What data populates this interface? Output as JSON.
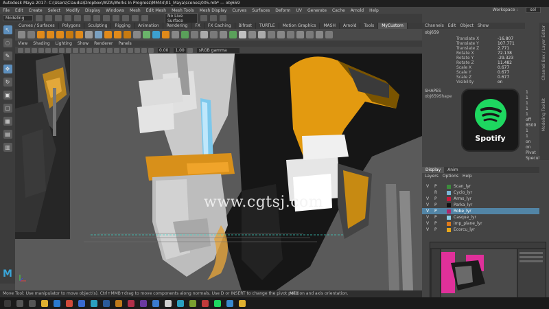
{
  "window": {
    "title": "Autodesk Maya 2017: C:\\Users\\Claudia\\Dropbox\\WZA\\Works In Progress\\MM44\\01_Maya\\scenes\\005.mb* — obj659"
  },
  "menubar": {
    "items": [
      "File",
      "Edit",
      "Create",
      "Select",
      "Modify",
      "Display",
      "Windows",
      "Mesh",
      "Edit Mesh",
      "Mesh Tools",
      "Mesh Display",
      "Curves",
      "Surfaces",
      "Deform",
      "UV",
      "Generate",
      "Cache",
      "Arnold",
      "Help"
    ],
    "workspace_label": "Workspace :",
    "workspace_value": "sel"
  },
  "statusline": {
    "mode": "Modeling",
    "live_surface": "No Live Surface"
  },
  "shelf": {
    "tabs": [
      "Curves / Surfaces",
      "Polygons",
      "Sculpting",
      "Rigging",
      "Animation",
      "Rendering",
      "FX",
      "FX Caching",
      "Bifrost",
      "TURTLE",
      "Motion Graphics",
      "MASH",
      "Arnold",
      "Tools",
      "MyCustom"
    ],
    "active_tab": "MyCustom"
  },
  "viewport": {
    "menu": [
      "View",
      "Shading",
      "Lighting",
      "Show",
      "Renderer",
      "Panels"
    ],
    "near_value": "0.00",
    "far_value": "1.00",
    "color_space": "sRGB gamma",
    "watermark": "www.cgtsj.com"
  },
  "channel_box": {
    "menu": [
      "Channels",
      "Edit",
      "Object",
      "Show"
    ],
    "object_name": "obj659",
    "attributes": [
      {
        "label": "Translate X",
        "value": "-16.807"
      },
      {
        "label": "Translate Y",
        "value": "107.771"
      },
      {
        "label": "Translate Z",
        "value": "2.771"
      },
      {
        "label": "Rotate X",
        "value": "72.138"
      },
      {
        "label": "Rotate Y",
        "value": "-29.323"
      },
      {
        "label": "Rotate Z",
        "value": "11.482"
      },
      {
        "label": "Scale X",
        "value": "0.677"
      },
      {
        "label": "Scale Y",
        "value": "0.677"
      },
      {
        "label": "Scale Z",
        "value": "0.677"
      },
      {
        "label": "Visibility",
        "value": "on"
      }
    ],
    "shapes_label": "SHAPES",
    "shape_name": "obj659Shape",
    "side_values": [
      "1",
      "1",
      "1",
      "1",
      "1",
      "off",
      "8500",
      "1",
      "1",
      "on",
      "on"
    ],
    "side_bottom_label": "Pivot Specular"
  },
  "spotify": {
    "brand_text": "Spotify",
    "brand_color": "#1ed760"
  },
  "vertical_tabs": [
    "Channel Box / Layer Editor",
    "Modeling Toolkit"
  ],
  "layer_editor": {
    "tabs": [
      "Display",
      "Anim"
    ],
    "active_tab": "Display",
    "menu": [
      "Layers",
      "Options",
      "Help"
    ],
    "layers": [
      {
        "v": "V",
        "p": "P",
        "name": "Scan_lyr",
        "color": "#3c8c3c",
        "selected": false
      },
      {
        "v": "",
        "p": "R",
        "name": "Cyclo_lyr",
        "color": "#7ab6d6",
        "selected": false
      },
      {
        "v": "V",
        "p": "P",
        "name": "Arms_lyr",
        "color": "#c8183c",
        "selected": false
      },
      {
        "v": "V",
        "p": "P",
        "name": "Parka_lyr",
        "color": "#111111",
        "selected": false
      },
      {
        "v": "V",
        "p": "P",
        "name": "Robe_lyr",
        "color": "#b0286a",
        "selected": true
      },
      {
        "v": "V",
        "p": "P",
        "name": "Casque_lyr",
        "color": "#8ed0e8",
        "selected": false
      },
      {
        "v": "V",
        "p": "P",
        "name": "imp_plane_lyr",
        "color": "#e07a1a",
        "selected": false
      },
      {
        "v": "V",
        "p": "P",
        "name": "Ecorcu_lyr",
        "color": "#e8a81a",
        "selected": false
      }
    ]
  },
  "status": {
    "help_line": "Move Tool: Use manipulator to move object(s). Ctrl+MMB+drag to move components along normals. Use D or INSERT to change the pivot position and axis orientation.",
    "command_label": "MEL"
  },
  "icons": [
    "maya-logo-icon",
    "select-tool-icon",
    "move-tool-icon",
    "spotify-icon"
  ]
}
